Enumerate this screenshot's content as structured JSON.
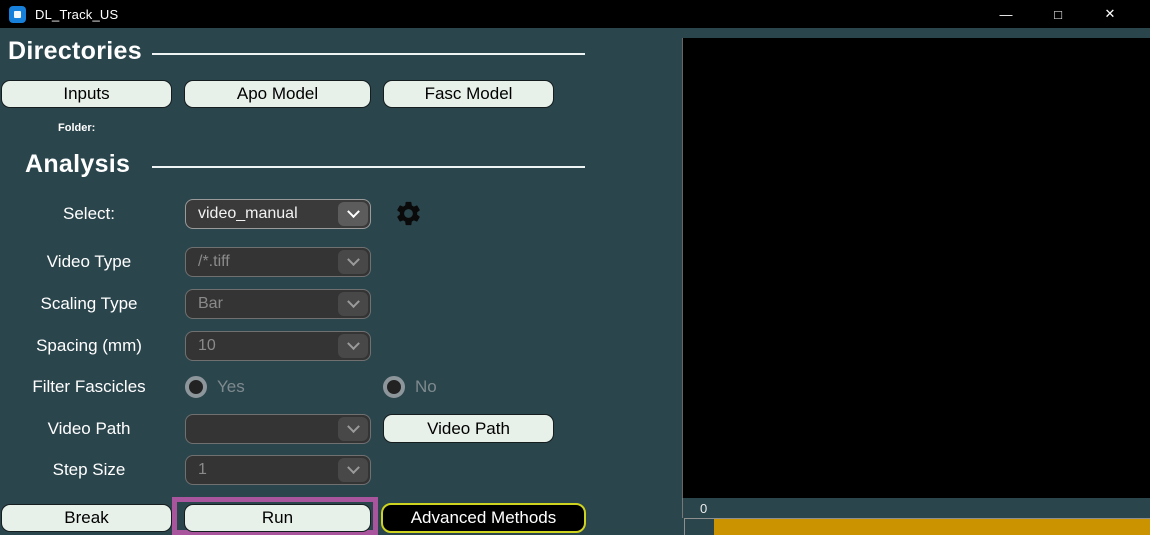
{
  "titlebar": {
    "title": "DL_Track_US",
    "minimize": "—",
    "maximize": "□",
    "close": "✕"
  },
  "directories": {
    "heading": "Directories",
    "inputs_button": "Inputs",
    "apo_model_button": "Apo Model",
    "fasc_model_button": "Fasc Model",
    "folder_label": "Folder:"
  },
  "analysis": {
    "heading": "Analysis",
    "select_label": "Select:",
    "select_value": "video_manual",
    "video_type_label": "Video Type",
    "video_type_value": "/*.tiff",
    "scaling_type_label": "Scaling Type",
    "scaling_type_value": "Bar",
    "spacing_label": "Spacing (mm)",
    "spacing_value": "10",
    "filter_label": "Filter Fascicles",
    "filter_yes": "Yes",
    "filter_no": "No",
    "video_path_label": "Video Path",
    "video_path_value": "",
    "video_path_button": "Video Path",
    "step_size_label": "Step Size",
    "step_size_value": "1"
  },
  "actions": {
    "break_button": "Break",
    "run_button": "Run",
    "advanced_button": "Advanced Methods"
  },
  "display_panel": {
    "progress_label": "0"
  },
  "colors": {
    "background_teal": "#2b454d",
    "button_mint": "#e7f1e9",
    "progress_orange": "#cc9301",
    "run_highlight_purple": "#a8559e",
    "advanced_border_yellow": "#ced31f",
    "titlebar_black": "#000000",
    "app_icon_blue": "#1780da"
  }
}
